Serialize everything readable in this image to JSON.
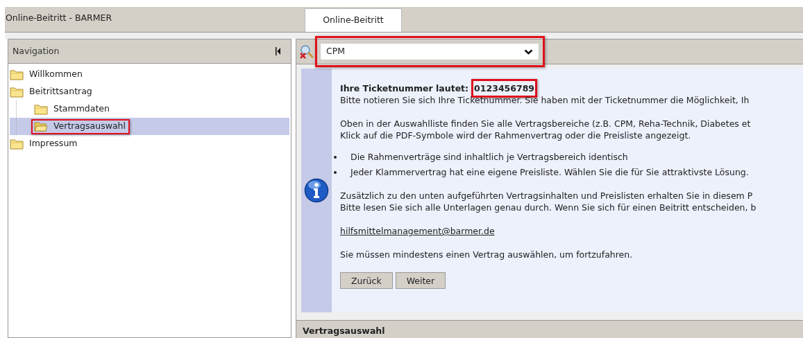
{
  "window": {
    "title": "Online-Beitritt - BARMER"
  },
  "tabs": [
    {
      "label": "Online-Beitritt",
      "selected": true
    }
  ],
  "navigation": {
    "title": "Navigation",
    "items": [
      {
        "label": "Willkommen",
        "selected": false,
        "highlighted": false
      },
      {
        "label": "Beitrittsantrag",
        "selected": false,
        "highlighted": false,
        "children": [
          {
            "label": "Stammdaten",
            "selected": false,
            "highlighted": false
          },
          {
            "label": "Vertragsauswahl",
            "selected": true,
            "highlighted": true
          }
        ]
      },
      {
        "label": "Impressum",
        "selected": false,
        "highlighted": false
      }
    ]
  },
  "toolbar": {
    "select": {
      "value": "CPM",
      "highlighted": true
    }
  },
  "info": {
    "ticket_label": "Ihre Ticketnummer lautet:",
    "ticket_number": "0123456789",
    "ticket_highlighted": true,
    "paragraphs": [
      {
        "kind": "text",
        "lines": [
          "Bitte notieren Sie sich Ihre Ticketnummer. Sie haben mit der Ticketnummer die Möglichkeit, Ih"
        ]
      },
      {
        "kind": "text",
        "lines": [
          "Oben in der Auswahlliste finden Sie alle Vertragsbereiche (z.B. CPM, Reha-Technik, Diabetes et",
          "Klick auf die PDF-Symbole wird der Rahmenvertrag oder die Preisliste angezeigt."
        ]
      },
      {
        "kind": "bullets",
        "lines": [
          "Die Rahmenverträge sind inhaltlich je Vertragsbereich identisch",
          "Jeder Klammervertrag hat eine eigene Preisliste. Wählen Sie die für Sie attraktivste Lösung."
        ]
      },
      {
        "kind": "text",
        "lines": [
          "Zusätzlich zu den unten aufgeführten Vertragsinhalten und Preislisten erhalten Sie in diesem P",
          "Bitte lesen Sie sich alle Unterlagen genau durch. Wenn Sie sich für einen Beitritt entscheiden, b"
        ]
      },
      {
        "kind": "link",
        "lines": [
          "hilfsmittelmanagement@barmer.de"
        ]
      },
      {
        "kind": "text",
        "lines": [
          "Sie müssen mindestens einen Vertrag auswählen, um fortzufahren."
        ]
      }
    ],
    "buttons": [
      "Zurück",
      "Weiter"
    ]
  },
  "section_title": "Vertragsauswahl"
}
